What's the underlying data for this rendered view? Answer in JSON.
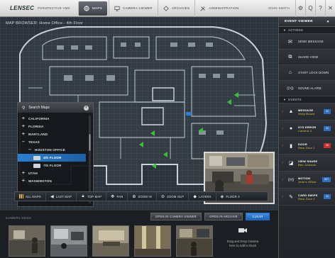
{
  "header": {
    "brand": "LENSEC",
    "product": "PERSPECTIVE VMS",
    "tabs": [
      {
        "label": "MAPS",
        "active": true,
        "icon": "globe-icon"
      },
      {
        "label": "CAMERA VIEWER",
        "active": false,
        "icon": "monitor-icon"
      },
      {
        "label": "ARCHIVES",
        "active": false,
        "icon": "archive-icon"
      },
      {
        "label": "ADMINISTRATION",
        "active": false,
        "icon": "tools-icon"
      }
    ],
    "user": "JOHN SMITH",
    "icons": [
      "gear-icon",
      "search-icon",
      "help-icon",
      "close-icon"
    ],
    "icon_glyphs": [
      "⚙",
      "Q",
      "?",
      "✕"
    ]
  },
  "map": {
    "title": "MAP BROWSER: Home Office - 4th Floor"
  },
  "search_panel": {
    "title": "Search Maps",
    "items": [
      {
        "label": "CALIFORNIA",
        "level": 0,
        "toggle": "+"
      },
      {
        "label": "FLORIDA",
        "level": 0,
        "toggle": "+"
      },
      {
        "label": "MARYLAND",
        "level": 0,
        "toggle": "+"
      },
      {
        "label": "TEXAS",
        "level": 0,
        "toggle": "–"
      },
      {
        "label": "HOUSTON OFFICE",
        "level": 1,
        "toggle": "–"
      },
      {
        "label": "4th FLOOR",
        "level": 2,
        "toggle": "",
        "selected": true
      },
      {
        "label": "7th FLOOR",
        "level": 2,
        "toggle": ""
      },
      {
        "label": "UTAH",
        "level": 0,
        "toggle": "+"
      },
      {
        "label": "WASHINGTON",
        "level": 0,
        "toggle": "+"
      }
    ]
  },
  "map_toolbar": [
    {
      "label": "ALL MAPS",
      "icon": "grid-icon"
    },
    {
      "label": "LAST MAP",
      "icon": "arrow-left-icon",
      "glyph": "◀"
    },
    {
      "label": "TOP MAP",
      "icon": "arrow-up-icon",
      "glyph": "▲"
    },
    {
      "label": "PAN",
      "icon": "pan-icon",
      "glyph": "✥"
    },
    {
      "label": "ZOOM IN",
      "icon": "zoom-in-icon",
      "glyph": "⊕"
    },
    {
      "label": "ZOOM OUT",
      "icon": "zoom-out-icon",
      "glyph": "⊖"
    },
    {
      "label": "LAYERS",
      "icon": "layers-icon",
      "glyph": "◆"
    },
    {
      "label": "FLOOR 4",
      "icon": "floor-icon",
      "glyph": "◈"
    }
  ],
  "dock": {
    "label": "CAMERA DOCK",
    "buttons": {
      "open_viewer": "OPEN IN CAMERA VIEWER",
      "open_archive": "OPEN IN ARCHIVE",
      "clear": "CLEAR"
    },
    "drop_text": "Drag and Drop Camera here to Add to Dock"
  },
  "event_viewer": {
    "title": "EVENT VIEWER",
    "actions_label": "ACTIONS",
    "actions": [
      {
        "label": "SEND MESSAGE",
        "icon": "envelope-icon",
        "glyph": "✉"
      },
      {
        "label": "SHARE VIEW",
        "icon": "share-icon",
        "glyph": "⧉"
      },
      {
        "label": "START LOCK DOWN",
        "icon": "lock-icon",
        "glyph": "⌂"
      },
      {
        "label": "SOUND ALARM",
        "icon": "alarm-icon",
        "glyph": "((•))"
      }
    ],
    "events_label": "EVENTS",
    "events": [
      {
        "type": "MESSAGE",
        "detail": "Holly Brown",
        "icon": "message-icon",
        "glyph": "▲",
        "badge": "41",
        "badge_color": "#2f6fc2"
      },
      {
        "type": "SYS ERROR",
        "detail": "Camera 4",
        "icon": "error-icon",
        "glyph": "●",
        "badge": "41",
        "badge_color": "#2f6fc2"
      },
      {
        "type": "DOOR",
        "detail": "Rear Door 1",
        "icon": "door-icon",
        "glyph": "▮",
        "badge": "26",
        "badge_color": "#c8302f"
      },
      {
        "type": "VIEW SHARE",
        "detail": "Ben Johnson",
        "icon": "view-share-icon",
        "glyph": "◪",
        "badge": "",
        "badge_color": ""
      },
      {
        "type": "MOTION",
        "detail": "Jean's Office",
        "icon": "motion-icon",
        "glyph": "((•))",
        "badge": "527",
        "badge_color": "#2f6fc2"
      },
      {
        "type": "CARD SWIPE",
        "detail": "Rear Door 1",
        "icon": "card-swipe-icon",
        "glyph": "✎",
        "badge": "41",
        "badge_color": "#2f6fc2"
      }
    ]
  },
  "colors": {
    "accent": "#2a7fd0",
    "camera_marker": "#37c23a",
    "event_highlight": "#e9c23f"
  }
}
